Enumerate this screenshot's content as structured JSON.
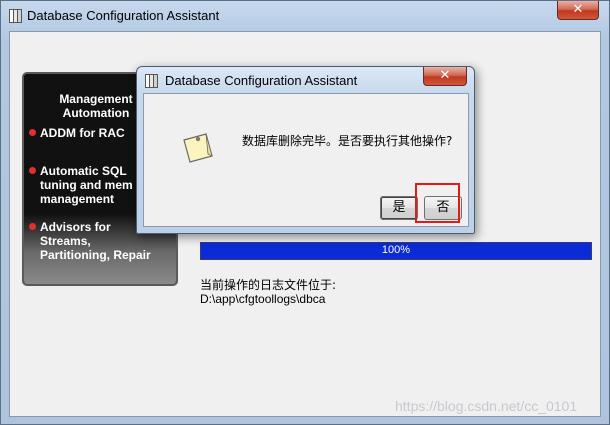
{
  "main_window": {
    "title": "Database Configuration Assistant",
    "close_glyph": "✕",
    "icon": "dbca-app-icon"
  },
  "image_panel": {
    "heading_line1": "Management",
    "heading_line2": "Automation",
    "bullets": [
      {
        "lines": [
          "ADDM for RAC"
        ]
      },
      {
        "lines": [
          "Automatic SQL",
          "tuning and mem",
          "management"
        ]
      },
      {
        "lines": [
          "Advisors for",
          "Streams,",
          "Partitioning, Repair"
        ]
      }
    ]
  },
  "progress": {
    "percent": 100,
    "label": "100%"
  },
  "log": {
    "label": "当前操作的日志文件位于:",
    "path": "D:\\app\\cfgtoollogs\\dbca"
  },
  "dialog": {
    "title": "Database Configuration Assistant",
    "close_glyph": "✕",
    "icon": "note-icon",
    "message": "数据库删除完毕。是否要执行其他操作?",
    "yes_label": "是",
    "no_label": "否"
  },
  "watermark": "https://blog.csdn.net/cc_0101",
  "colors": {
    "progress_fill": "#0a2bd6",
    "highlight": "#e31a1a",
    "close_button": "#c0391f"
  }
}
